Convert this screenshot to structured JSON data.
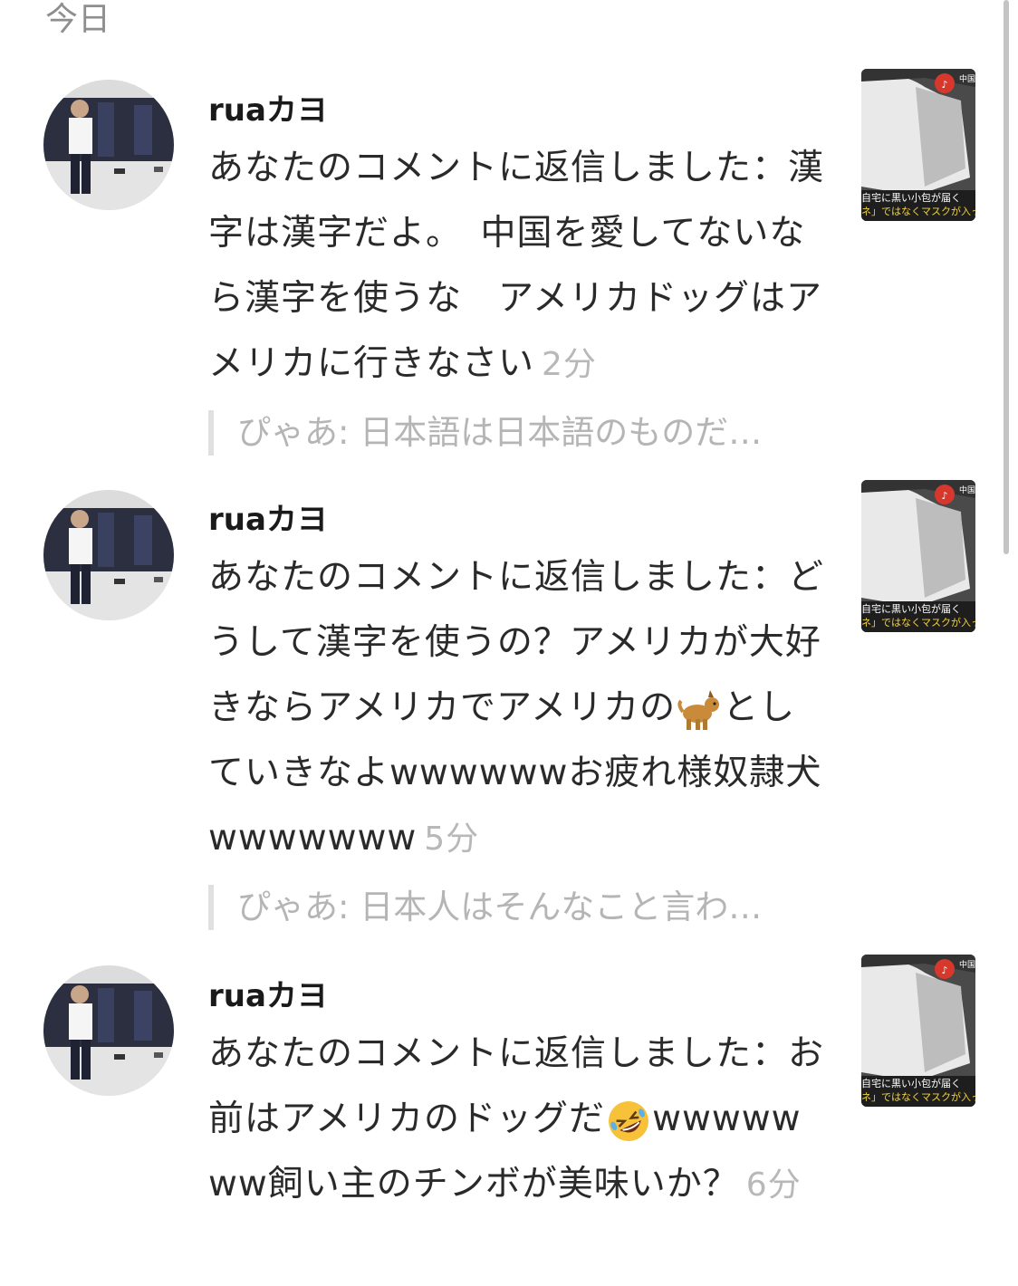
{
  "header": {
    "section_label": "今日"
  },
  "notifications": [
    {
      "username": "ruaカヨ",
      "message": "あなたのコメントに返信しました：漢字は漢字だよ。　中国を愛してないなら漢字を使うな　アメリカドッグはアメリカに行きなさい",
      "time": "2分",
      "quote": "ぴゃあ: 日本語は日本語のものだ…"
    },
    {
      "username": "ruaカヨ",
      "message_before_emoji": "あなたのコメントに返信しました：どうして漢字を使うの？アメリカが大好きならアメリカでアメリカの",
      "emoji": "dog-emoji",
      "message_after_emoji": "としていきなよwwwwwwお疲れ様奴隷犬wwwwwww",
      "time": "5分",
      "quote": "ぴゃあ: 日本人はそんなこと言わ…"
    },
    {
      "username": "ruaカヨ",
      "message_before_emoji": "あなたのコメントに返信しました：お前はアメリカのドッグだ",
      "emoji": "rolling-laughing-emoji",
      "message_after_emoji": "wwwwwww飼い主のチンボが美味いか？",
      "time": "6分"
    }
  ],
  "thumbnail_caption": {
    "top": "中国からタネ",
    "line1": "自宅に黒い小包が届く",
    "line2": "ネ」ではなくマスクが入っ"
  },
  "colors": {
    "muted_text": "#b5b5b5",
    "header_text": "#8e8e8e",
    "quote_border": "#e0e0e0"
  }
}
